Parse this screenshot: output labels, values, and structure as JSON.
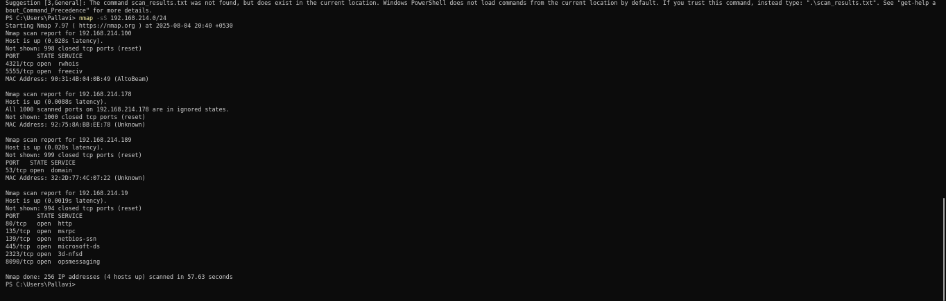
{
  "terminal": {
    "suggestion_line1": "Suggestion [3,General]: The command scan_results.txt was not found, but does exist in the current location. Windows PowerShell does not load commands from the current location by default. If you trust this command, instead type: \".\\scan_results.txt\". See \"get-help a",
    "suggestion_line2": "bout_Command_Precedence\" for more details.",
    "prompt": "PS C:\\Users\\Pallavi> ",
    "command": "nmap",
    "flag": "-sS",
    "target": "192.168.214.0/24",
    "start": "Starting Nmap 7.97 ( https://nmap.org ) at 2025-08-04 20:40 +0530",
    "host1": {
      "report": "Nmap scan report for 192.168.214.100",
      "up": "Host is up (0.028s latency).",
      "not_shown": "Not shown: 998 closed tcp ports (reset)",
      "header": "PORT     STATE SERVICE",
      "ports": [
        "4321/tcp open  rwhois",
        "5555/tcp open  freeciv"
      ],
      "mac": "MAC Address: 90:31:4B:04:0B:49 (AltoBeam)"
    },
    "host2": {
      "report": "Nmap scan report for 192.168.214.178",
      "up": "Host is up (0.0088s latency).",
      "all_ignored": "All 1000 scanned ports on 192.168.214.178 are in ignored states.",
      "not_shown": "Not shown: 1000 closed tcp ports (reset)",
      "mac": "MAC Address: 92:75:8A:BB:EE:78 (Unknown)"
    },
    "host3": {
      "report": "Nmap scan report for 192.168.214.189",
      "up": "Host is up (0.020s latency).",
      "not_shown": "Not shown: 999 closed tcp ports (reset)",
      "header": "PORT   STATE SERVICE",
      "ports": [
        "53/tcp open  domain"
      ],
      "mac": "MAC Address: 32:2D:77:4C:07:22 (Unknown)"
    },
    "host4": {
      "report": "Nmap scan report for 192.168.214.19",
      "up": "Host is up (0.0019s latency).",
      "not_shown": "Not shown: 994 closed tcp ports (reset)",
      "header": "PORT     STATE SERVICE",
      "ports": [
        "80/tcp   open  http",
        "135/tcp  open  msrpc",
        "139/tcp  open  netbios-ssn",
        "445/tcp  open  microsoft-ds",
        "2323/tcp open  3d-nfsd",
        "8090/tcp open  opsmessaging"
      ]
    },
    "done": "Nmap done: 256 IP addresses (4 hosts up) scanned in 57.63 seconds",
    "final_prompt": "PS C:\\Users\\Pallavi>",
    "colors": {
      "background": "#0c0c0c",
      "text": "#cccccc",
      "command": "#f9f1a5",
      "parameter": "#767676",
      "scrollbar": "#a8a8a8"
    }
  }
}
